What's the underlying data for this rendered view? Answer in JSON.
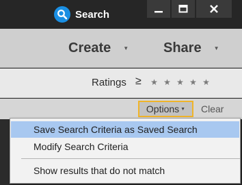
{
  "titlebar": {
    "search_label": "Search",
    "icons": {
      "search": "search-icon",
      "minimize": "minimize-icon",
      "maximize": "maximize-icon",
      "close": "close-icon"
    }
  },
  "actionbar": {
    "create_label": "Create",
    "share_label": "Share",
    "caret": "▼"
  },
  "ratings": {
    "label": "Ratings",
    "operator": "≥",
    "star_glyph": "★",
    "stars_selected": 0,
    "stars_total": 5
  },
  "optionsbar": {
    "options_label": "Options",
    "options_caret": "▼",
    "clear_label": "Clear"
  },
  "menu": {
    "items": [
      {
        "label": "Save Search Criteria as Saved Search",
        "highlighted": true
      },
      {
        "label": "Modify Search Criteria",
        "highlighted": false
      },
      {
        "label": "Show results that do not match",
        "highlighted": false
      }
    ]
  },
  "colors": {
    "accent_blue": "#1a8fe3",
    "highlight": "#a8c8f0",
    "focus_border": "#f0b429",
    "titlebar_bg": "#262626"
  }
}
